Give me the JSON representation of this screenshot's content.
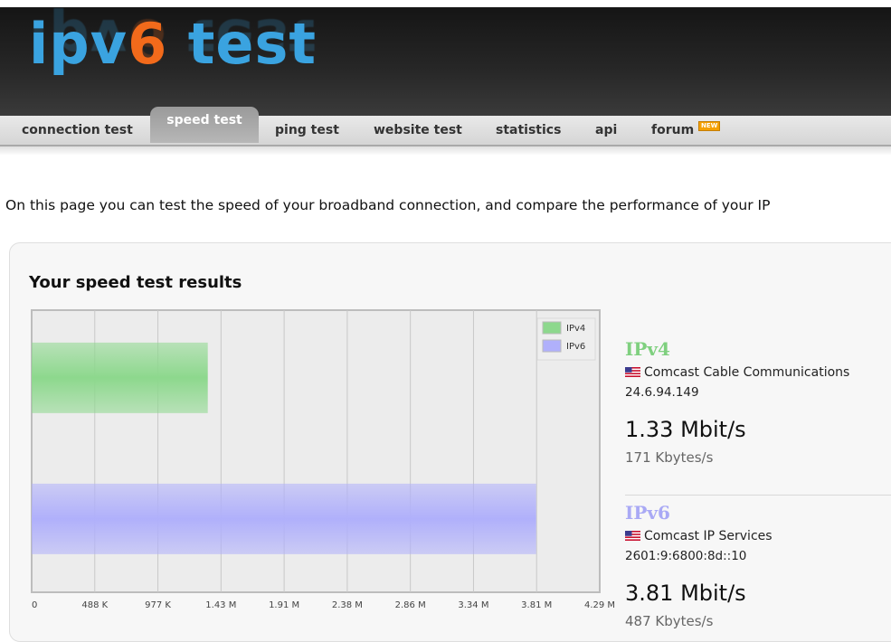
{
  "logo": {
    "part1": "ipv",
    "part2": "6",
    "part3": " test"
  },
  "nav": {
    "items": [
      {
        "label": "connection test"
      },
      {
        "label": "speed test"
      },
      {
        "label": "ping test"
      },
      {
        "label": "website test"
      },
      {
        "label": "statistics"
      },
      {
        "label": "api"
      },
      {
        "label": "forum",
        "badge": "NEW"
      }
    ],
    "active": "speed test"
  },
  "intro": "On this page you can test the speed of your broadband connection, and compare the performance of your IP",
  "results": {
    "title": "Your speed test results",
    "ipv4": {
      "name": "IPv4",
      "isp": "Comcast Cable Communications",
      "ip": "24.6.94.149",
      "speed": "1.33 Mbit/s",
      "bytes": "171 Kbytes/s",
      "color": "#7fd07f"
    },
    "ipv6": {
      "name": "IPv6",
      "isp": "Comcast IP Services",
      "ip": "2601:9:6800:8d::10",
      "speed": "3.81 Mbit/s",
      "bytes": "487 Kbytes/s",
      "color": "#a9a9f5"
    }
  },
  "chart_data": {
    "type": "bar",
    "orientation": "horizontal",
    "title": "",
    "categories": [
      "IPv4",
      "IPv6"
    ],
    "series": [
      {
        "name": "IPv4",
        "values": [
          1.33
        ],
        "color": "#8dd88d"
      },
      {
        "name": "IPv6",
        "values": [
          3.81
        ],
        "color": "#b0b0fb"
      }
    ],
    "x_ticks": [
      "0",
      "488 K",
      "977 K",
      "1.43 M",
      "1.91 M",
      "2.38 M",
      "2.86 M",
      "3.34 M",
      "3.81 M",
      "4.29 M"
    ],
    "xlim": [
      0,
      4.29
    ],
    "units": "Mbit/s",
    "grid": true,
    "legend": "top-right"
  }
}
